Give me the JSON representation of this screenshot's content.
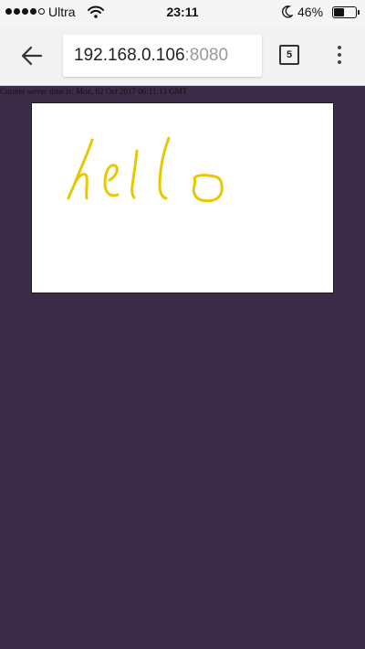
{
  "status_bar": {
    "carrier": "Ultra",
    "time": "23:11",
    "battery_percent": "46%",
    "battery_level": 0.46,
    "signal_bars_filled": 4,
    "signal_bars_total": 5
  },
  "browser": {
    "url_host": "192.168.0.106",
    "url_port": ":8080",
    "tab_count": "5"
  },
  "page": {
    "server_time": "Current server time is: Mon, 02 Oct 2017 06:11:13 GMT",
    "drawing_text": "hello"
  },
  "colors": {
    "page_background": "#3c2c48",
    "ink": "#e8c800",
    "canvas": "#ffffff"
  },
  "icons": {
    "back": "arrow-left",
    "tabs": "tab-switcher",
    "menu": "vertical-ellipsis",
    "wifi": "wifi",
    "moon": "do-not-disturb-moon",
    "battery": "battery"
  }
}
